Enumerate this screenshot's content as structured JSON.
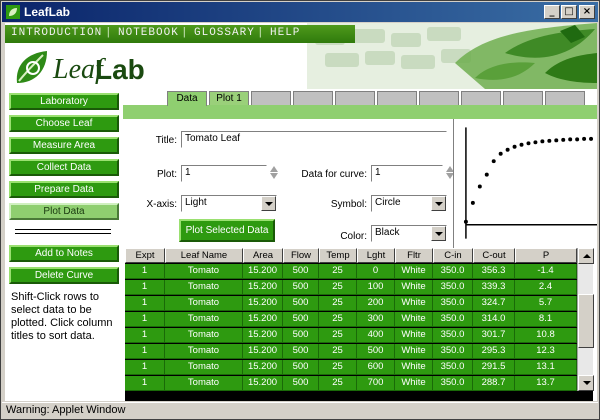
{
  "window": {
    "title": "LeafLab",
    "status": "Warning: Applet Window"
  },
  "header": {
    "menu": [
      "INTRODUCTION",
      "NOTEBOOK",
      "GLOSSARY",
      "HELP"
    ],
    "logo_word1": "Leaf",
    "logo_word2": "Lab"
  },
  "nav": {
    "items": [
      "Laboratory",
      "Choose Leaf",
      "Measure Area",
      "Collect Data",
      "Prepare Data",
      "Plot Data"
    ],
    "active": "Plot Data",
    "add_to_notes": "Add to Notes",
    "delete_curve": "Delete Curve",
    "help": "Shift-Click rows to select data to be plotted. Click column titles to sort data."
  },
  "tabs": [
    "Data",
    "Plot 1",
    "",
    "",
    "",
    "",
    "",
    "",
    "",
    ""
  ],
  "form": {
    "title_label": "Title:",
    "title_value": "Tomato Leaf",
    "plot_label": "Plot:",
    "plot_value": "1",
    "data_for_curve_label": "Data for curve:",
    "data_for_curve_value": "1",
    "xaxis_label": "X-axis:",
    "xaxis_value": "Light",
    "symbol_label": "Symbol:",
    "symbol_value": "Circle",
    "color_label": "Color:",
    "color_value": "Black",
    "plot_button": "Plot Selected Data"
  },
  "table": {
    "columns": [
      "Expt",
      "Leaf Name",
      "Area",
      "Flow",
      "Temp",
      "Lght",
      "Fltr",
      "C-in",
      "C-out",
      "P"
    ],
    "rows": [
      [
        "1",
        "Tomato",
        "15.200",
        "500",
        "25",
        "0",
        "White",
        "350.0",
        "356.3",
        "-1.4"
      ],
      [
        "1",
        "Tomato",
        "15.200",
        "500",
        "25",
        "100",
        "White",
        "350.0",
        "339.3",
        "2.4"
      ],
      [
        "1",
        "Tomato",
        "15.200",
        "500",
        "25",
        "200",
        "White",
        "350.0",
        "324.7",
        "5.7"
      ],
      [
        "1",
        "Tomato",
        "15.200",
        "500",
        "25",
        "300",
        "White",
        "350.0",
        "314.0",
        "8.1"
      ],
      [
        "1",
        "Tomato",
        "15.200",
        "500",
        "25",
        "400",
        "White",
        "350.0",
        "301.7",
        "10.8"
      ],
      [
        "1",
        "Tomato",
        "15.200",
        "500",
        "25",
        "500",
        "White",
        "350.0",
        "295.3",
        "12.3"
      ],
      [
        "1",
        "Tomato",
        "15.200",
        "500",
        "25",
        "600",
        "White",
        "350.0",
        "291.5",
        "13.1"
      ],
      [
        "1",
        "Tomato",
        "15.200",
        "500",
        "25",
        "700",
        "White",
        "350.0",
        "288.7",
        "13.7"
      ]
    ]
  },
  "preview_curve": [
    -1.4,
    2.4,
    5.7,
    8.1,
    10.8,
    12.3,
    13.1,
    13.7,
    14.1,
    14.4,
    14.6,
    14.8,
    14.9,
    15.0,
    15.1,
    15.2,
    15.2,
    15.3,
    15.3
  ],
  "colors": {
    "accent": "#2e9a10",
    "active_nav": "#8fcf70",
    "title_bar": "#0a246a"
  }
}
